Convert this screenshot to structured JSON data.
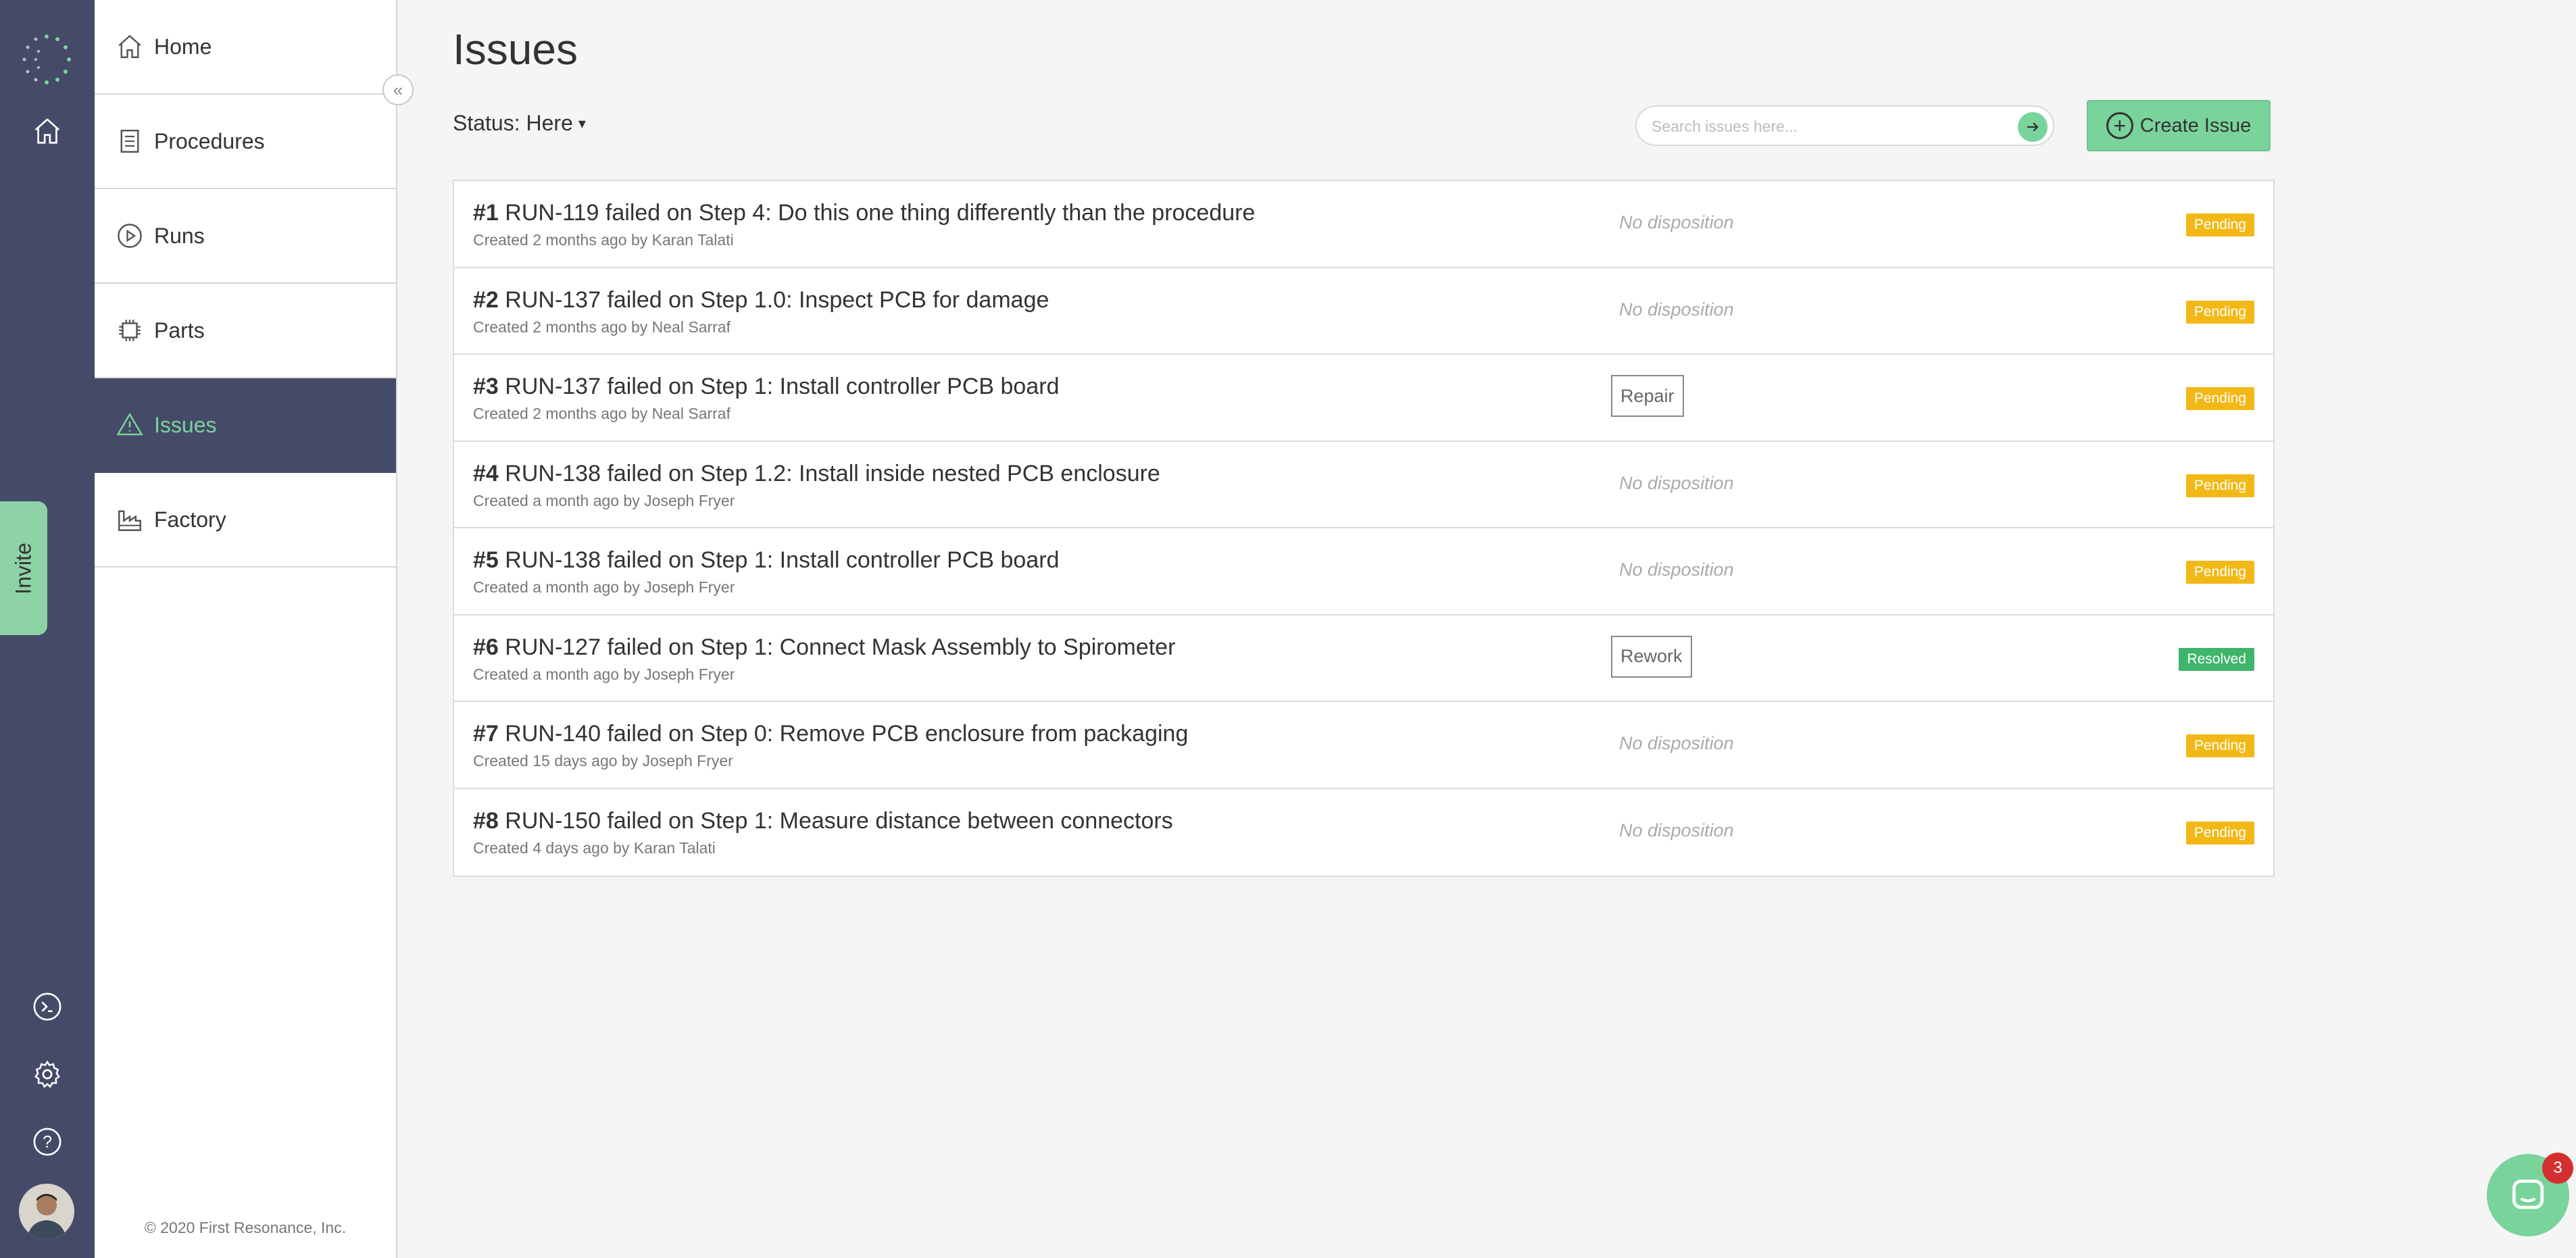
{
  "sidebar": {
    "items": [
      {
        "label": "Home",
        "icon": "home-icon"
      },
      {
        "label": "Procedures",
        "icon": "document-icon"
      },
      {
        "label": "Runs",
        "icon": "play-icon"
      },
      {
        "label": "Parts",
        "icon": "chip-icon"
      },
      {
        "label": "Issues",
        "icon": "warning-icon",
        "active": true
      },
      {
        "label": "Factory",
        "icon": "factory-icon"
      }
    ],
    "copyright": "© 2020 First Resonance, Inc."
  },
  "rail": {
    "invite_label": "Invite"
  },
  "main": {
    "title": "Issues",
    "status_filter": "Status: Here",
    "search_placeholder": "Search issues here...",
    "create_label": "Create Issue"
  },
  "issues": [
    {
      "num": "#1",
      "title": "RUN-119 failed on Step 4: Do this one thing differently than the procedure",
      "meta": "Created 2 months ago by Karan Talati",
      "disposition": "No disposition",
      "has_disposition": false,
      "status": "Pending"
    },
    {
      "num": "#2",
      "title": "RUN-137 failed on Step 1.0: Inspect PCB for damage",
      "meta": "Created 2 months ago by Neal Sarraf",
      "disposition": "No disposition",
      "has_disposition": false,
      "status": "Pending"
    },
    {
      "num": "#3",
      "title": "RUN-137 failed on Step 1: Install controller PCB board",
      "meta": "Created 2 months ago by Neal Sarraf",
      "disposition": "Repair",
      "has_disposition": true,
      "status": "Pending"
    },
    {
      "num": "#4",
      "title": "RUN-138 failed on Step 1.2: Install inside nested PCB enclosure",
      "meta": "Created a month ago by Joseph Fryer",
      "disposition": "No disposition",
      "has_disposition": false,
      "status": "Pending"
    },
    {
      "num": "#5",
      "title": "RUN-138 failed on Step 1: Install controller PCB board",
      "meta": "Created a month ago by Joseph Fryer",
      "disposition": "No disposition",
      "has_disposition": false,
      "status": "Pending"
    },
    {
      "num": "#6",
      "title": "RUN-127 failed on Step 1: Connect Mask Assembly to Spirometer",
      "meta": "Created a month ago by Joseph Fryer",
      "disposition": "Rework",
      "has_disposition": true,
      "status": "Resolved"
    },
    {
      "num": "#7",
      "title": "RUN-140 failed on Step 0: Remove PCB enclosure from packaging",
      "meta": "Created 15 days ago by Joseph Fryer",
      "disposition": "No disposition",
      "has_disposition": false,
      "status": "Pending"
    },
    {
      "num": "#8",
      "title": "RUN-150 failed on Step 1: Measure distance between connectors",
      "meta": "Created 4 days ago by Karan Talati",
      "disposition": "No disposition",
      "has_disposition": false,
      "status": "Pending"
    }
  ],
  "status_colors": {
    "Pending": "#f2b816",
    "Resolved": "#3fb56b"
  },
  "chat": {
    "unread_count": "3"
  },
  "colors": {
    "rail": "#454a68",
    "accent": "#7ad39b"
  }
}
